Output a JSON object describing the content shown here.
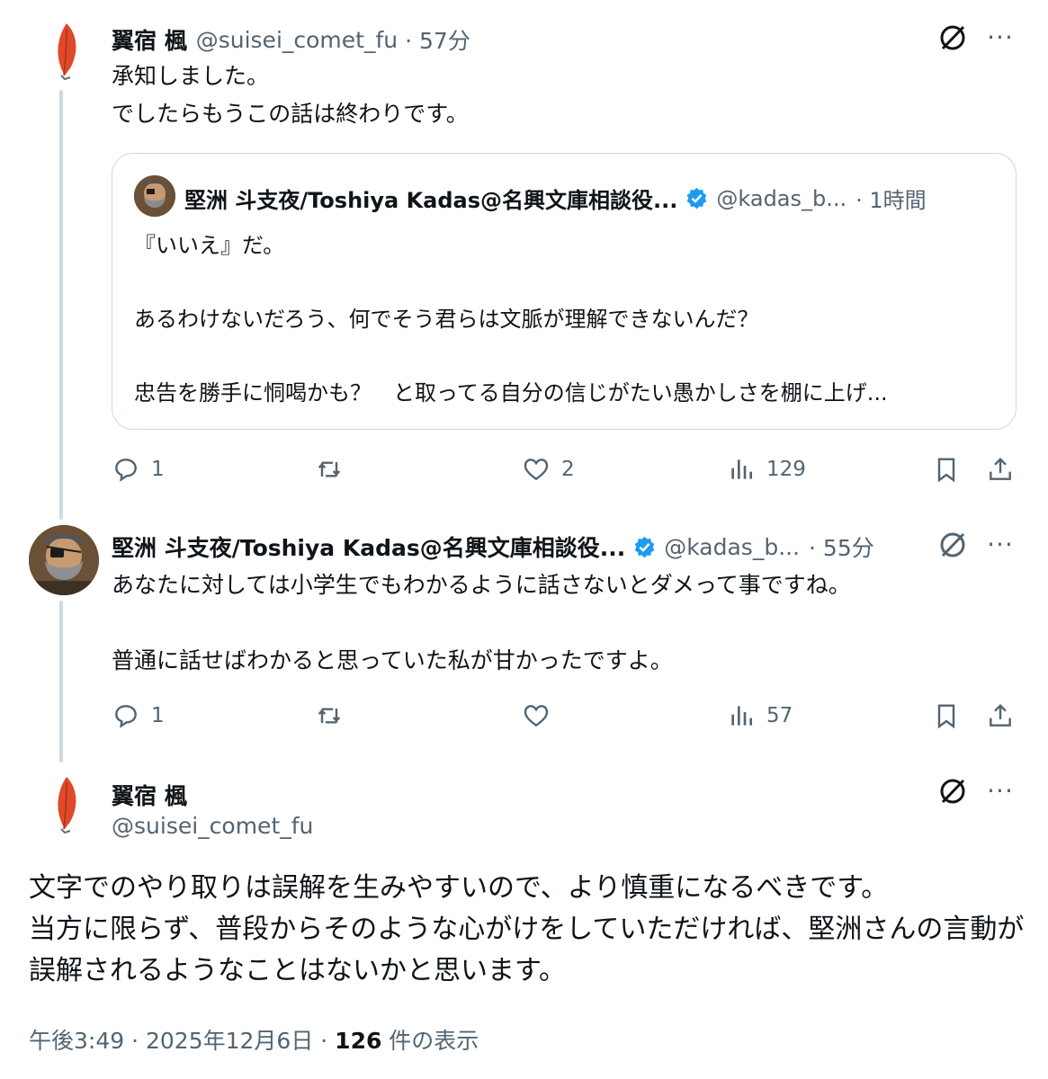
{
  "tweet1": {
    "name": "翼宿 楓",
    "handle": "@suisei_comet_fu",
    "time": "· 57分",
    "text": "承知しました。\nでしたらもうこの話は終わりです。",
    "quote": {
      "name": "堅洲 斗支夜/Toshiya Kadas@名興文庫相談役...",
      "handle": "@kadas_b...",
      "time": "· 1時間",
      "text": "『いいえ』だ。\n\nあるわけないだろう、何でそう君らは文脈が理解できないんだ？\n\n忠告を勝手に恫喝かも？　と取ってる自分の信じがたい愚かしさを棚に上げ..."
    },
    "actions": {
      "replies": "1",
      "retweets": "",
      "likes": "2",
      "views": "129"
    }
  },
  "tweet2": {
    "name": "堅洲 斗支夜/Toshiya Kadas@名興文庫相談役...",
    "handle": "@kadas_b...",
    "time": "· 55分",
    "text": "あなたに対しては小学生でもわかるように話さないとダメって事ですね。\n\n普通に話せばわかると思っていた私が甘かったですよ。",
    "actions": {
      "replies": "1",
      "retweets": "",
      "likes": "",
      "views": "57"
    }
  },
  "main_tweet": {
    "name": "翼宿 楓",
    "handle": "@suisei_comet_fu",
    "text": "文字でのやり取りは誤解を生みやすいので、より慎重になるべきです。\n当方に限らず、普段からそのような心がけをしていただければ、堅洲さんの言動が誤解されるようなことはないかと思います。",
    "timestamp": "午後3:49 · 2025年12月6日 · ",
    "view_count": "126",
    "view_label": " 件の表示"
  },
  "icons": {
    "more": "more-icon",
    "grok": "grok-icon",
    "reply": "reply-icon",
    "retweet": "retweet-icon",
    "like": "like-icon",
    "views": "views-icon",
    "bookmark": "bookmark-icon",
    "share": "share-icon",
    "verified": "verified-badge-icon"
  },
  "colors": {
    "text": "#0f1419",
    "muted": "#536471",
    "border": "#cfd9de",
    "verified": "#1d9bf0",
    "quill": "#e0492a"
  }
}
